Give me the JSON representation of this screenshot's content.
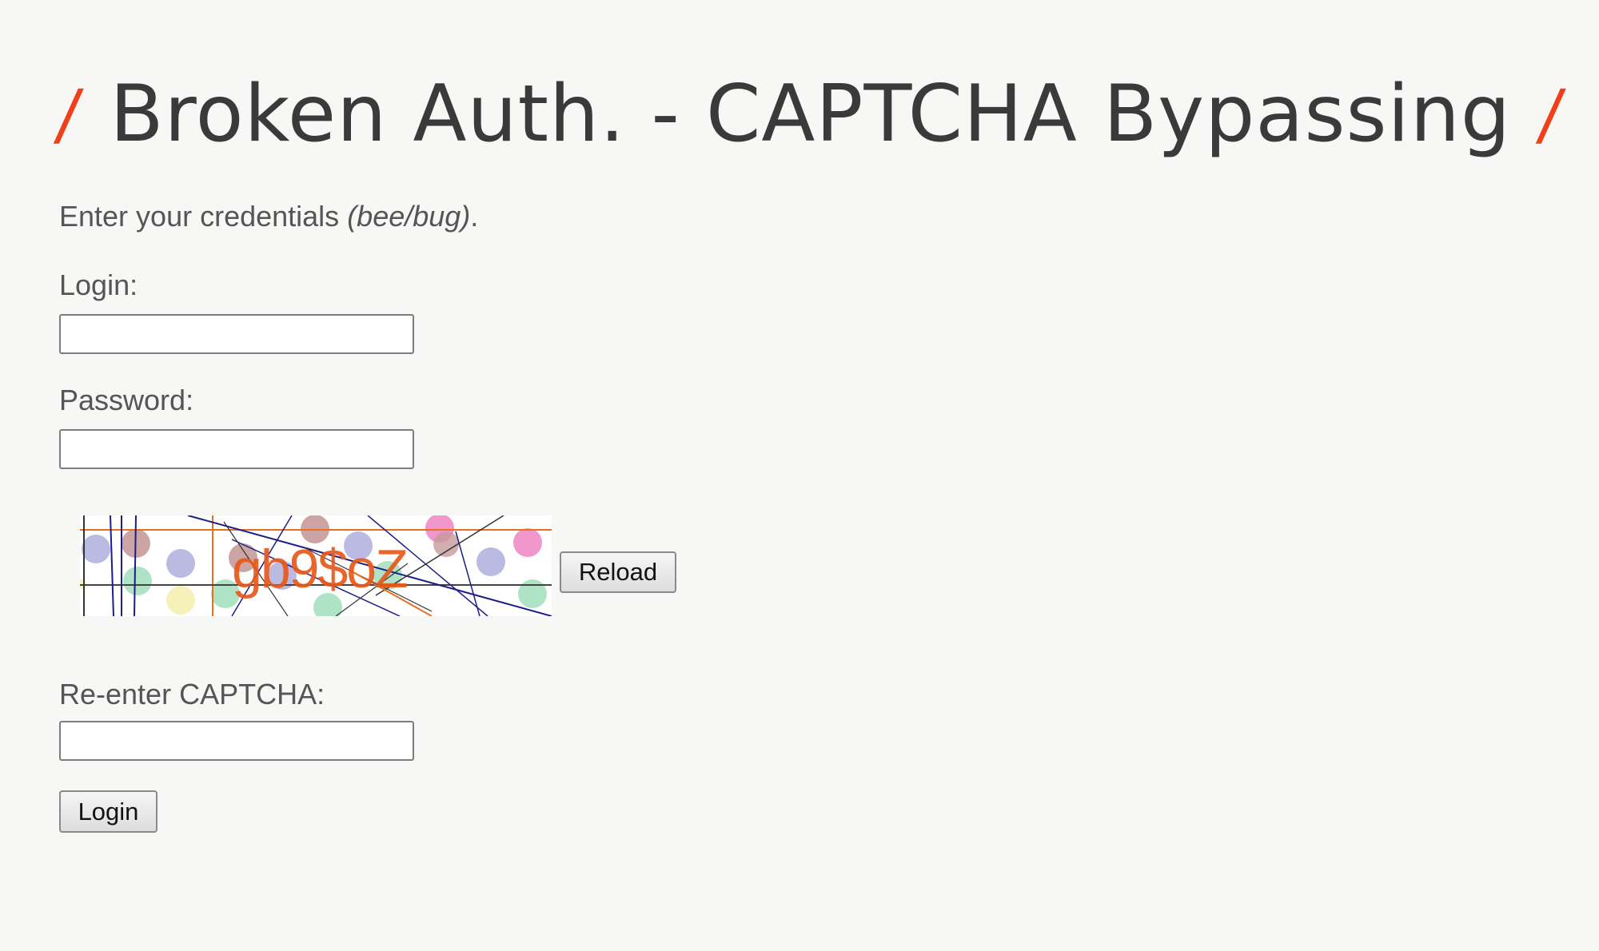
{
  "header": {
    "title": "Broken Auth. - CAPTCHA Bypassing",
    "slash": "/"
  },
  "form": {
    "intro_text": "Enter your credentials ",
    "intro_hint": "(bee/bug)",
    "intro_end": ".",
    "login_label": "Login:",
    "login_value": "",
    "password_label": "Password:",
    "password_value": "",
    "captcha_text": "gb9$oZ",
    "reload_label": "Reload",
    "reenter_label": "Re-enter CAPTCHA:",
    "reenter_value": "",
    "submit_label": "Login"
  },
  "colors": {
    "accent": "#f0401a",
    "captcha_text": "#e8581a",
    "title": "#3a3a3a",
    "background": "#f7f7f6"
  }
}
